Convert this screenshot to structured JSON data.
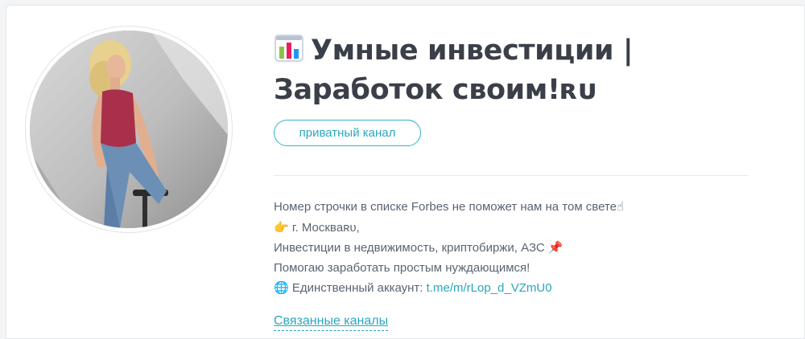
{
  "channel": {
    "title_icon": "bar-chart-icon",
    "title_line1": "Умные инвестиции |",
    "title_line2": "Заработок своим!ʀᴜ",
    "badge": "приватный канал",
    "description": {
      "line1_text": "Номер строчки в списке Forbes не поможет нам на том свете",
      "line1_emoji": "☝",
      "line2_emoji": "👉",
      "line2_text": " г. Москвaʀᴜ,",
      "line3_text": "Инвестиции в недвижимость, криптобиржи, АЗС ",
      "line3_emoji": "📌",
      "line4_text": "Помогаю заработать простым нуждающимся!",
      "line5_emoji": "🌐",
      "line5_text": " Единственный аккаунт: ",
      "line5_link": "t.me/m/rLop_d_VZmU0"
    },
    "related_link": "Связанные каналы"
  },
  "colors": {
    "accent": "#2ca7bf",
    "title": "#3a3f48",
    "text": "#5b6472"
  }
}
